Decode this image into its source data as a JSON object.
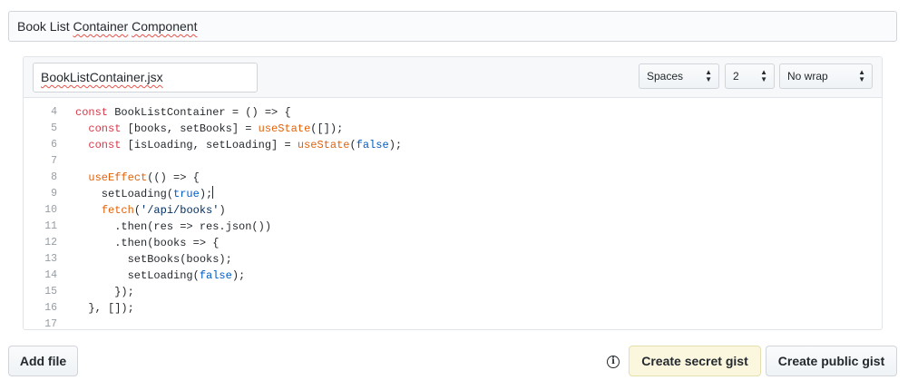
{
  "gist_description": {
    "value_word1": "Book List",
    "value_word2": "Container",
    "value_word3": "Component"
  },
  "file": {
    "filename_value": "BookListContainer.jsx",
    "indent_mode": {
      "selected": "Spaces",
      "icon": "updown-arrows-icon"
    },
    "indent_size": {
      "selected": "2",
      "icon": "updown-arrows-icon"
    },
    "wrap_mode": {
      "selected": "No wrap",
      "icon": "updown-arrows-icon"
    }
  },
  "code_lines": [
    {
      "no": "4",
      "tokens": [
        [
          "kw",
          "const"
        ],
        [
          "t",
          " BookListContainer = () => {"
        ]
      ]
    },
    {
      "no": "5",
      "tokens": [
        [
          "t",
          "  "
        ],
        [
          "kw",
          "const"
        ],
        [
          "t",
          " [books, setBooks] = "
        ],
        [
          "fn",
          "useState"
        ],
        [
          "t",
          "([]);"
        ]
      ]
    },
    {
      "no": "6",
      "tokens": [
        [
          "t",
          "  "
        ],
        [
          "kw",
          "const"
        ],
        [
          "t",
          " [isLoading, setLoading] = "
        ],
        [
          "fn",
          "useState"
        ],
        [
          "t",
          "("
        ],
        [
          "bool",
          "false"
        ],
        [
          "t",
          ");"
        ]
      ]
    },
    {
      "no": "7",
      "tokens": []
    },
    {
      "no": "8",
      "tokens": [
        [
          "t",
          "  "
        ],
        [
          "fn",
          "useEffect"
        ],
        [
          "t",
          "(() => {"
        ]
      ]
    },
    {
      "no": "9",
      "tokens": [
        [
          "t",
          "    setLoading("
        ],
        [
          "bool",
          "true"
        ],
        [
          "t",
          ");"
        ],
        [
          "caret",
          ""
        ]
      ]
    },
    {
      "no": "10",
      "tokens": [
        [
          "t",
          "    "
        ],
        [
          "fn",
          "fetch"
        ],
        [
          "t",
          "("
        ],
        [
          "str",
          "'/api/books'"
        ],
        [
          "t",
          ")"
        ]
      ]
    },
    {
      "no": "11",
      "tokens": [
        [
          "t",
          "      .then(res => res.json())"
        ]
      ]
    },
    {
      "no": "12",
      "tokens": [
        [
          "t",
          "      .then(books => {"
        ]
      ]
    },
    {
      "no": "13",
      "tokens": [
        [
          "t",
          "        setBooks(books);"
        ]
      ]
    },
    {
      "no": "14",
      "tokens": [
        [
          "t",
          "        setLoading("
        ],
        [
          "bool",
          "false"
        ],
        [
          "t",
          ");"
        ]
      ]
    },
    {
      "no": "15",
      "tokens": [
        [
          "t",
          "      });"
        ]
      ]
    },
    {
      "no": "16",
      "tokens": [
        [
          "t",
          "  }, []);"
        ]
      ]
    },
    {
      "no": "17",
      "tokens": []
    }
  ],
  "actions": {
    "add_file": "Add file",
    "info_icon": "info-icon",
    "create_secret": "Create secret gist",
    "create_public": "Create public gist"
  },
  "colors": {
    "keyword": "#d73a49",
    "function": "#e36209",
    "boolean": "#005cc5",
    "string": "#032f62",
    "secret_button_bg": "#fbf7df"
  }
}
